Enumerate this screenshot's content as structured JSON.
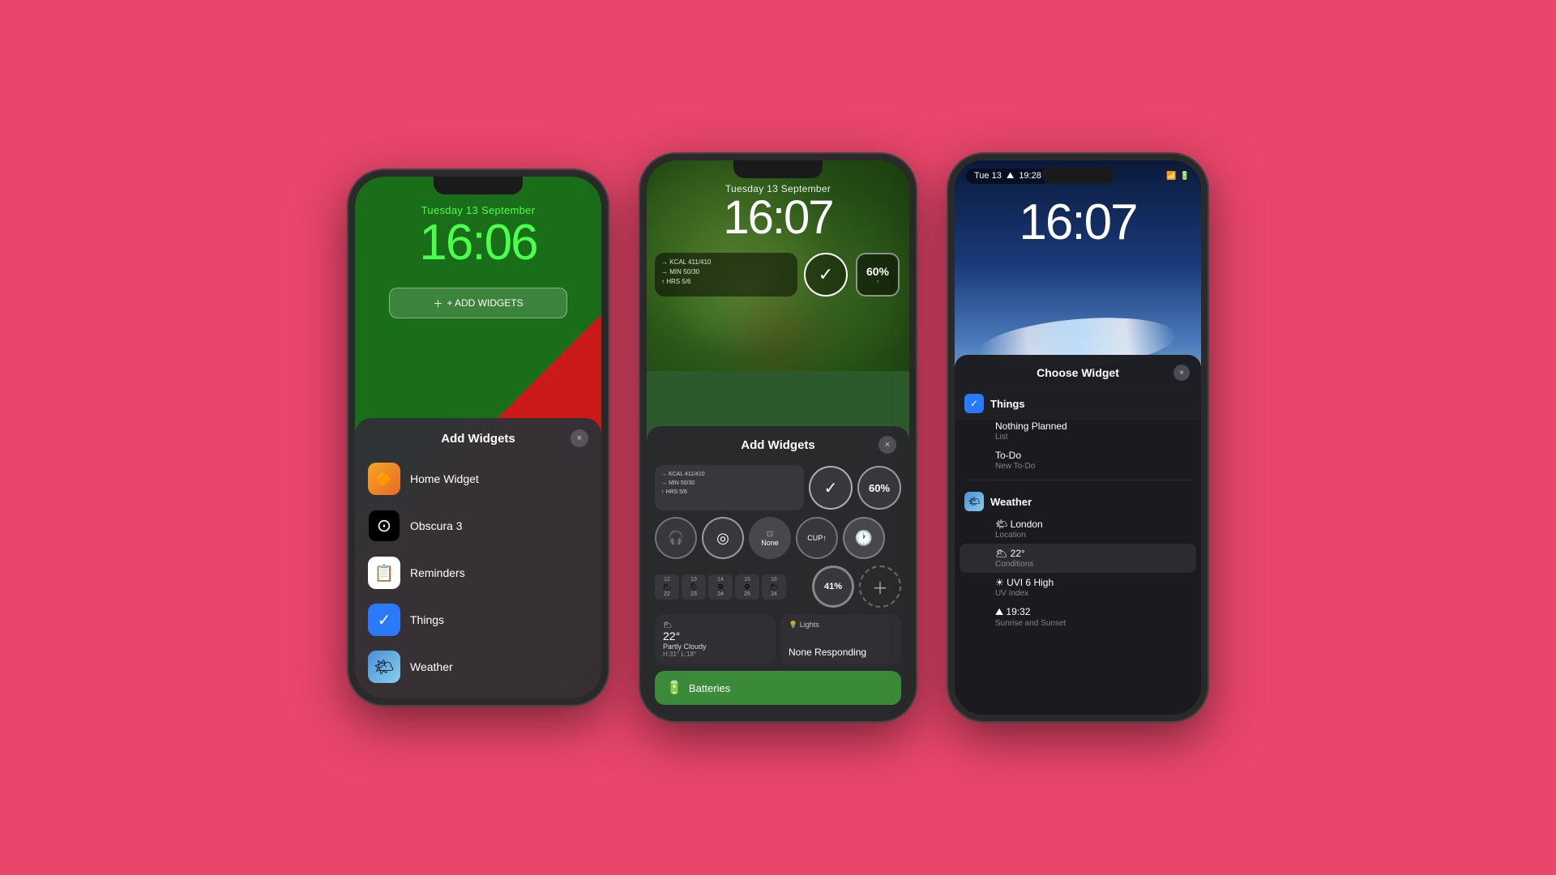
{
  "background_color": "#e8466a",
  "phone1": {
    "date": "Tuesday 13 September",
    "time": "16:06",
    "add_widgets_button": "+ ADD WIDGETS",
    "panel_title": "Add Widgets",
    "close_label": "×",
    "widgets": [
      {
        "name": "Home Widget",
        "icon_type": "homewidget",
        "emoji": "🔶"
      },
      {
        "name": "Obscura 3",
        "icon_type": "obscura",
        "emoji": "⭕"
      },
      {
        "name": "Reminders",
        "icon_type": "reminders",
        "emoji": "📋"
      },
      {
        "name": "Things",
        "icon_type": "things",
        "emoji": "✓"
      },
      {
        "name": "Weather",
        "icon_type": "weather",
        "emoji": "🌤"
      }
    ]
  },
  "phone2": {
    "date": "Tuesday 13 September",
    "time": "16:07",
    "panel_title": "Add Widgets",
    "close_label": "×",
    "widget_stats": {
      "kcal": "411/410",
      "min": "50/30",
      "hrs": "5/6",
      "percent1": "60%",
      "percent2": "41%",
      "weather_temp": "22°",
      "weather_desc": "Partly Cloudy",
      "weather_hl": "H:31° L:18°",
      "lights_title": "Lights",
      "lights_status": "None Responding"
    },
    "batteries_label": "Batteries"
  },
  "phone3": {
    "status_left": "Tue 13",
    "status_time": "19:28",
    "time": "16:07",
    "panel_title": "Choose Widget",
    "close_label": "×",
    "sections": [
      {
        "title": "Things",
        "icon_type": "things",
        "color": "#2a7aff",
        "items": [
          {
            "title": "Nothing Planned",
            "sub": "List"
          },
          {
            "title": "To-Do",
            "sub": "New To-Do"
          }
        ]
      },
      {
        "title": "Weather",
        "icon_type": "weather",
        "color": "#4a90d9",
        "items": [
          {
            "title": "London",
            "sub": "Location"
          },
          {
            "title": "22°",
            "sub": "Conditions",
            "active": true
          },
          {
            "title": "UVI 6 High",
            "sub": "UV Index"
          },
          {
            "title": "19:32",
            "sub": "Sunrise and Sunset"
          }
        ]
      }
    ]
  }
}
